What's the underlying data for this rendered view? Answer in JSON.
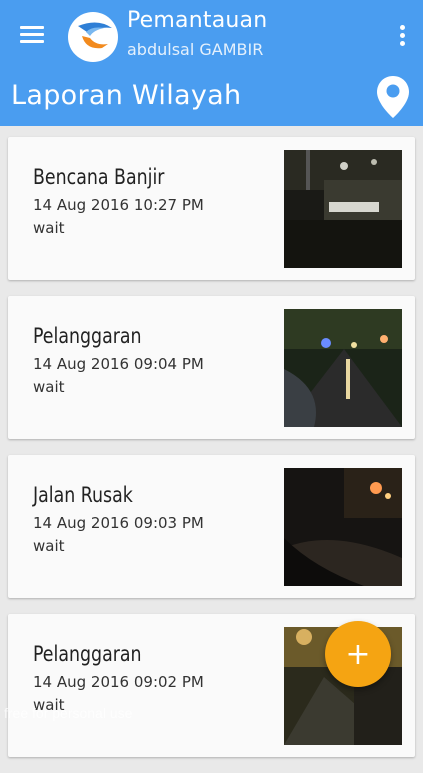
{
  "appbar": {
    "title": "Pemantauan",
    "subtitle": "abdulsal GAMBIR",
    "page_title": "Laporan Wilayah",
    "menu_icon": "hamburger-menu-icon",
    "overflow_icon": "more-vert-icon",
    "location_icon": "map-pin-icon"
  },
  "colors": {
    "appbar": "#4a9df0",
    "fab": "#f5a412",
    "background": "#e9e9e9"
  },
  "reports": [
    {
      "title": "Bencana Banjir",
      "date": "14 Aug 2016 10:27 PM",
      "status": "wait"
    },
    {
      "title": "Pelanggaran",
      "date": "14 Aug 2016 09:04 PM",
      "status": "wait"
    },
    {
      "title": "Jalan Rusak",
      "date": "14 Aug 2016 09:03 PM",
      "status": "wait"
    },
    {
      "title": "Pelanggaran",
      "date": "14 Aug 2016 09:02 PM",
      "status": "wait"
    }
  ],
  "fab": {
    "label": "+",
    "icon": "add-icon"
  },
  "watermark": "free for personal use"
}
